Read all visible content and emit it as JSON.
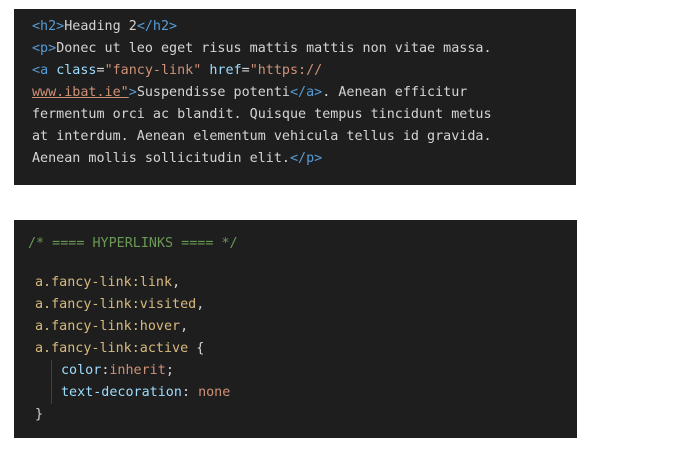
{
  "html_block": {
    "line1": {
      "open": "<h2>",
      "text": "Heading 2",
      "close": "</h2>"
    },
    "line2": {
      "open": "<p>",
      "text": "Donec ut leo eget risus mattis mattis non vitae massa."
    },
    "line3": {
      "lt": "<",
      "tag": "a",
      "attr1": "class",
      "eq": "=",
      "val1": "\"fancy-link\"",
      "attr2": "href",
      "eq2": "=",
      "val2a": "\"https://"
    },
    "line4": {
      "val2b": "www.ibat.ie\"",
      "gt": ">",
      "text": "Suspendisse potenti",
      "close": "</a>",
      "after": ". Aenean efficitur"
    },
    "line5": {
      "text": "fermentum orci ac blandit. Quisque tempus tincidunt metus"
    },
    "line6": {
      "text": "at interdum. Aenean elementum vehicula tellus id gravida."
    },
    "line7": {
      "text": "Aenean mollis sollicitudin elit.",
      "close": "</p>"
    }
  },
  "css_block": {
    "comment": "/* ==== HYPERLINKS ==== */",
    "selectors": [
      {
        "sel": "a.fancy-link:link",
        "punct": ","
      },
      {
        "sel": "a.fancy-link:visited",
        "punct": ","
      },
      {
        "sel": "a.fancy-link:hover",
        "punct": ","
      },
      {
        "sel": "a.fancy-link:active",
        "punct": " {"
      }
    ],
    "decl1": {
      "prop": "color",
      "colon": ":",
      "val": "inherit",
      "semi": ";"
    },
    "decl2": {
      "prop": "text-decoration",
      "colon": ": ",
      "val": "none"
    },
    "close": "}"
  }
}
